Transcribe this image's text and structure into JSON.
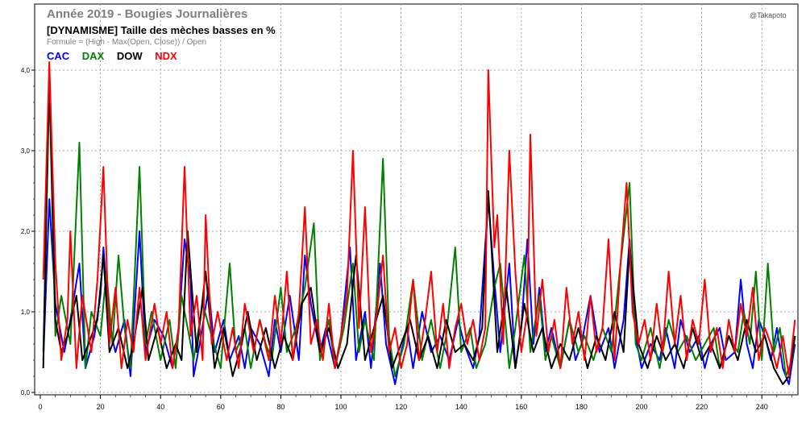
{
  "header": {
    "title": "Année 2019 - Bougies Journalières",
    "subtitle": "[DYNAMISME] Taille des mèches basses en %",
    "formula": "Formule = (High - Max(Open, Close)) / Open",
    "credit": "@Takapoto"
  },
  "colors": {
    "CAC": "#0000ff",
    "DAX": "#008000",
    "DOW": "#000000",
    "NDX": "#ff0000",
    "grid": "#8c8c8c",
    "title": "#7f7f7f"
  },
  "chart_data": {
    "type": "line",
    "title": "Année 2019 - Bougies Journalières",
    "subtitle": "[DYNAMISME] Taille des mèches basses en %",
    "xlim": [
      0,
      252
    ],
    "ylim": [
      0,
      4.0
    ],
    "x_ticks": [
      0,
      20,
      40,
      60,
      80,
      100,
      120,
      140,
      160,
      180,
      200,
      220,
      240
    ],
    "y_ticks": [
      "0,0",
      "1,0",
      "2,0",
      "3,0",
      "4,0"
    ],
    "grid": true,
    "legend_position": "top-left",
    "series": [
      {
        "name": "CAC",
        "x": [
          1,
          3,
          5,
          8,
          10,
          13,
          15,
          18,
          20,
          21,
          23,
          25,
          28,
          30,
          33,
          35,
          38,
          41,
          44,
          46,
          48,
          50,
          51,
          53,
          56,
          58,
          61,
          63,
          66,
          68,
          70,
          73,
          76,
          78,
          80,
          83,
          86,
          88,
          90,
          93,
          95,
          98,
          100,
          103,
          105,
          108,
          110,
          113,
          115,
          118,
          120,
          122,
          124,
          127,
          130,
          133,
          136,
          139,
          141,
          144,
          146,
          149,
          151,
          153,
          156,
          158,
          160,
          162,
          164,
          166,
          168,
          170,
          173,
          176,
          178,
          180,
          183,
          186,
          189,
          191,
          194,
          196,
          198,
          200,
          203,
          206,
          208,
          211,
          213,
          216,
          219,
          221,
          223,
          226,
          228,
          231,
          233,
          235,
          237,
          239,
          241,
          243,
          245,
          247,
          249,
          251
        ],
        "values": [
          0.4,
          2.4,
          1.1,
          0.5,
          0.9,
          1.6,
          0.3,
          0.7,
          1.2,
          1.8,
          0.8,
          0.5,
          0.9,
          0.2,
          2.0,
          0.5,
          0.9,
          0.7,
          0.3,
          0.8,
          1.9,
          1.4,
          0.2,
          0.6,
          1.3,
          0.5,
          0.9,
          0.4,
          0.7,
          0.3,
          0.8,
          0.6,
          0.2,
          0.9,
          0.5,
          1.2,
          0.4,
          1.7,
          1.1,
          0.5,
          0.8,
          0.3,
          0.7,
          1.8,
          0.4,
          1.0,
          0.3,
          1.6,
          0.6,
          0.1,
          0.5,
          0.8,
          0.3,
          1.0,
          0.5,
          0.7,
          0.4,
          0.9,
          0.6,
          0.3,
          0.7,
          2.4,
          1.4,
          0.5,
          1.6,
          0.3,
          0.8,
          1.9,
          0.6,
          1.3,
          0.5,
          0.8,
          0.3,
          0.9,
          0.4,
          0.6,
          1.2,
          0.5,
          0.8,
          0.3,
          0.9,
          1.9,
          0.7,
          0.3,
          0.6,
          0.4,
          0.8,
          0.3,
          0.9,
          0.5,
          0.7,
          0.3,
          0.6,
          0.8,
          0.4,
          0.5,
          1.4,
          0.6,
          0.3,
          0.9,
          0.7,
          0.4,
          0.8,
          0.3,
          0.1,
          0.6
        ]
      },
      {
        "name": "DAX",
        "x": [
          1,
          3,
          5,
          7,
          10,
          13,
          15,
          17,
          20,
          22,
          24,
          26,
          28,
          30,
          33,
          35,
          37,
          40,
          43,
          45,
          47,
          49,
          51,
          54,
          57,
          60,
          63,
          65,
          68,
          70,
          73,
          75,
          77,
          80,
          82,
          85,
          88,
          91,
          93,
          96,
          98,
          101,
          104,
          106,
          108,
          111,
          114,
          116,
          118,
          121,
          124,
          127,
          130,
          133,
          135,
          138,
          140,
          143,
          145,
          148,
          151,
          153,
          156,
          158,
          161,
          163,
          166,
          168,
          170,
          173,
          176,
          179,
          181,
          184,
          187,
          190,
          193,
          196,
          198,
          200,
          203,
          206,
          209,
          212,
          215,
          218,
          221,
          224,
          226,
          229,
          232,
          234,
          236,
          238,
          240,
          242,
          244,
          246,
          248,
          250,
          251
        ],
        "values": [
          0.5,
          3.8,
          0.7,
          1.2,
          0.6,
          3.1,
          0.3,
          1.0,
          0.7,
          1.5,
          0.6,
          1.7,
          0.8,
          0.3,
          2.8,
          0.6,
          1.0,
          0.4,
          0.9,
          0.3,
          1.2,
          0.8,
          0.4,
          1.1,
          0.7,
          0.3,
          1.6,
          0.5,
          0.8,
          0.3,
          0.9,
          0.6,
          0.4,
          1.3,
          0.5,
          0.8,
          1.3,
          2.1,
          0.4,
          0.9,
          0.3,
          0.8,
          1.6,
          0.5,
          0.9,
          0.4,
          2.9,
          0.7,
          0.2,
          0.6,
          1.4,
          0.4,
          0.9,
          0.3,
          0.7,
          1.8,
          0.5,
          0.8,
          0.3,
          0.6,
          1.3,
          1.6,
          0.3,
          0.8,
          1.7,
          0.5,
          1.2,
          0.4,
          0.7,
          0.3,
          0.9,
          0.5,
          0.7,
          0.4,
          0.8,
          0.5,
          1.6,
          2.6,
          0.6,
          0.4,
          0.8,
          0.3,
          0.9,
          0.5,
          0.7,
          0.4,
          0.6,
          0.8,
          0.3,
          0.7,
          0.5,
          1.0,
          0.6,
          1.5,
          0.4,
          1.6,
          0.5,
          0.8,
          0.2,
          0.4,
          0.7
        ]
      },
      {
        "name": "DOW",
        "x": [
          1,
          3,
          5,
          7,
          9,
          12,
          14,
          16,
          19,
          21,
          23,
          26,
          29,
          31,
          34,
          36,
          39,
          42,
          45,
          47,
          49,
          52,
          55,
          58,
          61,
          64,
          67,
          69,
          72,
          75,
          78,
          81,
          84,
          87,
          90,
          93,
          96,
          99,
          102,
          105,
          108,
          111,
          114,
          117,
          120,
          123,
          126,
          129,
          132,
          135,
          138,
          141,
          144,
          147,
          149,
          152,
          155,
          158,
          161,
          164,
          167,
          170,
          173,
          176,
          179,
          182,
          185,
          188,
          191,
          194,
          196,
          199,
          202,
          205,
          208,
          211,
          214,
          217,
          220,
          223,
          226,
          229,
          232,
          235,
          238,
          241,
          244,
          247,
          249,
          251
        ],
        "values": [
          0.3,
          4.0,
          0.9,
          0.5,
          0.7,
          1.2,
          0.4,
          0.6,
          0.9,
          1.7,
          0.5,
          0.8,
          0.3,
          0.6,
          1.3,
          0.4,
          0.8,
          0.3,
          0.6,
          0.4,
          2.0,
          0.5,
          1.5,
          0.3,
          0.8,
          0.2,
          0.6,
          1.0,
          0.4,
          0.8,
          0.3,
          0.7,
          0.4,
          1.1,
          1.3,
          0.5,
          0.8,
          0.3,
          0.6,
          1.7,
          0.4,
          0.8,
          1.2,
          0.3,
          0.6,
          0.9,
          0.4,
          0.7,
          0.3,
          0.9,
          0.5,
          0.6,
          0.4,
          0.8,
          2.5,
          0.5,
          1.3,
          0.3,
          1.1,
          0.5,
          0.8,
          0.3,
          0.6,
          0.4,
          0.8,
          0.3,
          0.7,
          0.4,
          1.0,
          0.5,
          1.8,
          0.6,
          0.3,
          0.7,
          0.4,
          0.6,
          0.3,
          0.8,
          0.4,
          0.6,
          0.3,
          0.7,
          0.4,
          0.9,
          0.5,
          0.7,
          0.3,
          0.1,
          0.2,
          0.7
        ]
      },
      {
        "name": "NDX",
        "x": [
          1,
          3,
          5,
          7,
          9,
          10,
          12,
          14,
          17,
          19,
          21,
          23,
          25,
          27,
          29,
          31,
          33,
          35,
          38,
          40,
          42,
          44,
          46,
          48,
          50,
          52,
          54,
          55,
          57,
          59,
          62,
          64,
          66,
          68,
          71,
          73,
          76,
          78,
          80,
          82,
          84,
          86,
          88,
          90,
          92,
          94,
          96,
          98,
          100,
          102,
          104,
          106,
          108,
          110,
          112,
          114,
          116,
          118,
          120,
          122,
          124,
          126,
          128,
          130,
          132,
          134,
          136,
          138,
          140,
          142,
          144,
          146,
          148,
          149,
          151,
          152,
          154,
          156,
          158,
          160,
          162,
          163,
          165,
          167,
          169,
          171,
          173,
          175,
          177,
          179,
          181,
          183,
          185,
          187,
          189,
          191,
          193,
          195,
          197,
          199,
          201,
          203,
          205,
          207,
          209,
          211,
          213,
          215,
          217,
          219,
          221,
          223,
          225,
          227,
          229,
          231,
          233,
          235,
          237,
          239,
          241,
          243,
          245,
          247,
          249,
          251
        ],
        "values": [
          1.4,
          4.1,
          1.6,
          0.4,
          0.9,
          2.0,
          0.3,
          1.2,
          0.5,
          1.4,
          2.8,
          0.6,
          1.3,
          0.3,
          0.9,
          0.5,
          1.3,
          0.4,
          1.1,
          0.6,
          1.0,
          0.3,
          0.8,
          2.8,
          0.7,
          1.2,
          0.4,
          2.2,
          0.6,
          1.0,
          0.4,
          0.8,
          0.3,
          1.1,
          0.5,
          0.9,
          0.4,
          1.2,
          0.6,
          1.5,
          0.4,
          1.0,
          2.3,
          0.6,
          0.9,
          0.4,
          1.1,
          0.3,
          0.7,
          1.2,
          3.0,
          0.8,
          2.3,
          0.5,
          1.0,
          1.7,
          0.5,
          0.8,
          0.3,
          0.6,
          1.4,
          0.4,
          0.9,
          1.5,
          0.5,
          1.1,
          0.3,
          0.8,
          1.1,
          0.6,
          0.9,
          0.4,
          0.8,
          4.0,
          1.8,
          2.2,
          0.6,
          3.0,
          1.5,
          0.5,
          1.0,
          3.2,
          0.7,
          1.4,
          0.5,
          0.9,
          0.3,
          1.3,
          0.6,
          1.0,
          0.4,
          1.2,
          0.5,
          0.8,
          1.9,
          0.4,
          1.6,
          2.6,
          1.0,
          0.6,
          0.9,
          0.4,
          1.1,
          0.5,
          1.5,
          0.6,
          1.2,
          0.4,
          0.9,
          0.6,
          1.4,
          0.5,
          0.8,
          0.3,
          0.9,
          0.5,
          1.1,
          0.7,
          1.3,
          0.4,
          0.8,
          0.6,
          0.3,
          0.7,
          0.2,
          0.9
        ]
      }
    ]
  }
}
